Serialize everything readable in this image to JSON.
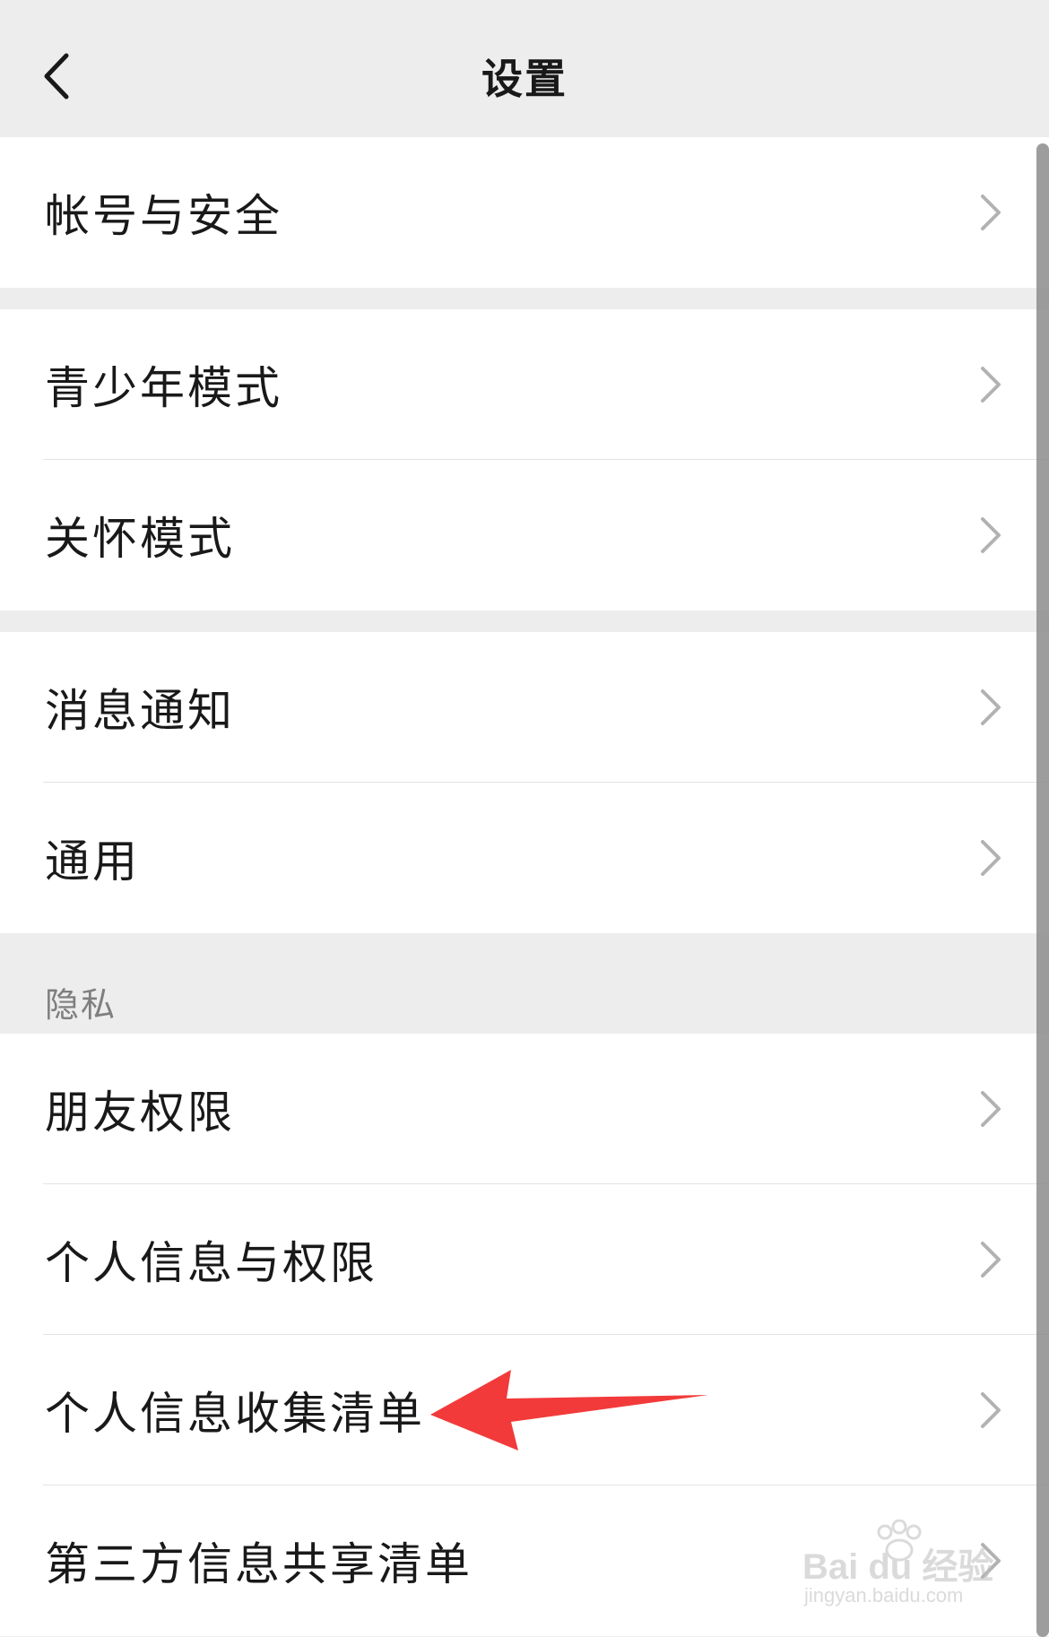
{
  "nav": {
    "title": "设置",
    "back_icon": "chevron-left-icon"
  },
  "groups": [
    {
      "items": [
        {
          "label": "帐号与安全"
        }
      ]
    },
    {
      "items": [
        {
          "label": "青少年模式"
        },
        {
          "label": "关怀模式"
        }
      ]
    },
    {
      "items": [
        {
          "label": "消息通知"
        },
        {
          "label": "通用"
        }
      ]
    },
    {
      "header": "隐私",
      "items": [
        {
          "label": "朋友权限"
        },
        {
          "label": "个人信息与权限"
        },
        {
          "label": "个人信息收集清单"
        },
        {
          "label": "第三方信息共享清单"
        }
      ]
    }
  ],
  "row_icon": "chevron-right-icon",
  "annotation": {
    "type": "arrow",
    "color": "#f23a3a",
    "points_to": "个人信息收集清单"
  },
  "watermark": {
    "brand": "Bai du 经验",
    "url": "jingyan.baidu.com"
  },
  "colors": {
    "background": "#ededed",
    "row": "#ffffff",
    "text": "#191919",
    "secondary_text": "#7f7f7f",
    "chevron": "#b2b2b2"
  }
}
